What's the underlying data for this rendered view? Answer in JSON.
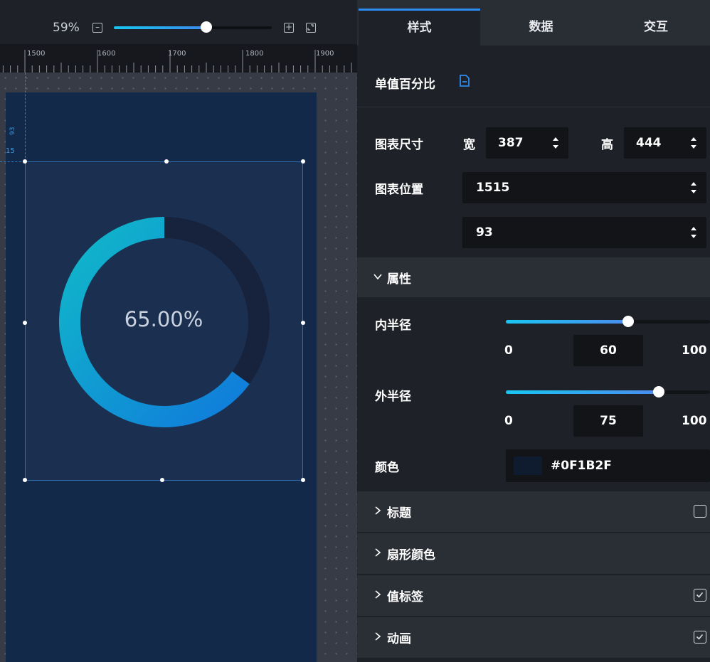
{
  "toolbar": {
    "zoom_label": "59%",
    "zoom_level_percent": 59,
    "zoom_minus_icon": "minus-square-icon",
    "zoom_plus_icon": "plus-square-icon",
    "fit_icon": "fit-screen-icon"
  },
  "ruler": {
    "labels": [
      "1500",
      "1600",
      "1700",
      "1800",
      "1900"
    ]
  },
  "guides": {
    "v_label": "93",
    "h_label": "15"
  },
  "canvas": {
    "widget": {
      "value_text": "65.00%",
      "percent": 65,
      "inner_radius": 60,
      "outer_radius": 75,
      "background_color": "#0F1B2F",
      "gradient_start": "#10bcc8",
      "gradient_end": "#1078dc",
      "track_color": "#17233d"
    }
  },
  "panel": {
    "tabs": [
      "样式",
      "数据",
      "交互"
    ],
    "active_tab": "样式",
    "title": "单值百分比",
    "title_icon": "document-icon",
    "size": {
      "label": "图表尺寸",
      "width_label": "宽",
      "width_value": "387",
      "height_label": "高",
      "height_value": "444"
    },
    "position": {
      "label": "图表位置",
      "x_value": "1515",
      "y_value": "93"
    },
    "properties": {
      "section_label": "属性",
      "inner_radius": {
        "label": "内半径",
        "min": "0",
        "value": "60",
        "max": "100"
      },
      "outer_radius": {
        "label": "外半径",
        "min": "0",
        "value": "75",
        "max": "100"
      },
      "color": {
        "label": "颜色",
        "value": "#0F1B2F"
      }
    },
    "collapsed_sections": [
      {
        "label": "标题",
        "checked": false
      },
      {
        "label": "扇形颜色"
      },
      {
        "label": "值标签",
        "checked": true
      },
      {
        "label": "动画",
        "checked": true
      }
    ]
  },
  "colors": {
    "accent": "#2d8cf0",
    "slider_start": "#19c6f2",
    "slider_end": "#4a8cf0"
  }
}
